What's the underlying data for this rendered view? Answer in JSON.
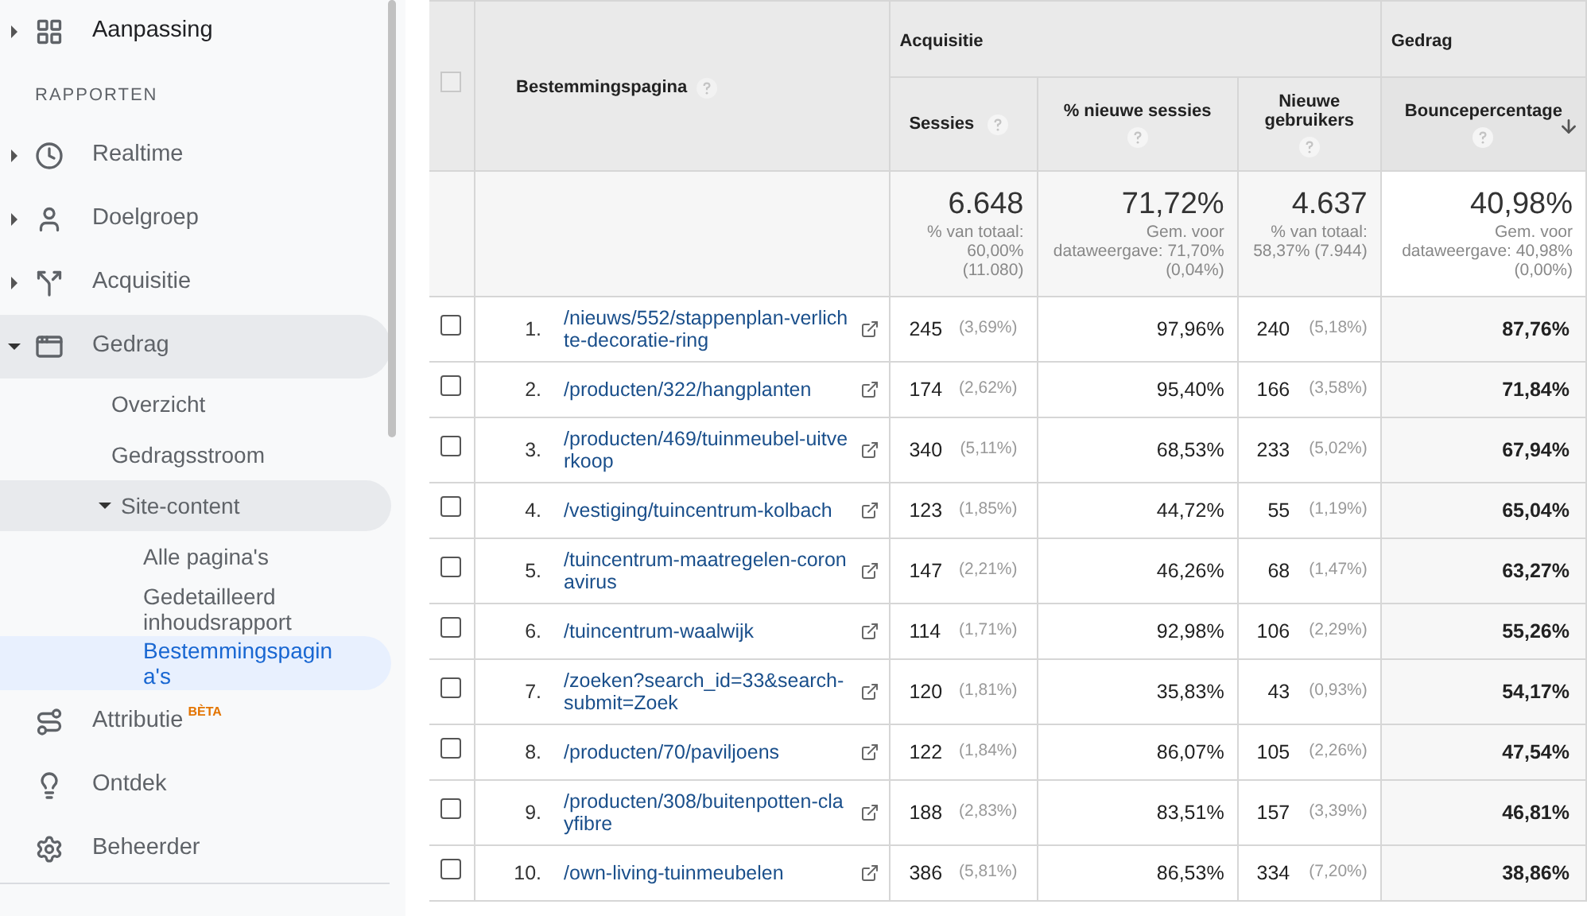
{
  "sidebar": {
    "items": [
      {
        "kind": "link",
        "label": "Aanpassing",
        "expanded": false
      },
      {
        "kind": "heading",
        "label": "RAPPORTEN"
      },
      {
        "kind": "link",
        "label": "Realtime",
        "expanded": false
      },
      {
        "kind": "link",
        "label": "Doelgroep",
        "expanded": false
      },
      {
        "kind": "link",
        "label": "Acquisitie",
        "expanded": false
      },
      {
        "kind": "link",
        "label": "Gedrag",
        "expanded": true,
        "children": [
          {
            "label": "Overzicht",
            "selected": false
          },
          {
            "label": "Gedragsstroom",
            "selected": false
          },
          {
            "label": "Site-content",
            "expanded": true,
            "children": [
              {
                "label": "Alle pagina's",
                "selected": false
              },
              {
                "label": "Gedetailleerd inhoudsrapport",
                "selected": false
              },
              {
                "label": "Bestemmingspagina's",
                "selected": true
              }
            ]
          }
        ]
      },
      {
        "kind": "link",
        "label": "Attributie",
        "badge": "BÈTA"
      },
      {
        "kind": "link",
        "label": "Ontdek"
      },
      {
        "kind": "link",
        "label": "Beheerder"
      }
    ]
  },
  "table": {
    "header_checkbox": {
      "checked": false
    },
    "dimension": {
      "label": "Bestemmingspagina"
    },
    "groups": [
      {
        "label": "Acquisitie"
      },
      {
        "label": "Gedrag"
      }
    ],
    "columns": [
      {
        "label": "Sessies",
        "sorted": false
      },
      {
        "label": "% nieuwe sessies",
        "sorted": false
      },
      {
        "label": "Nieuwe gebruikers",
        "sorted": false
      },
      {
        "label": "Bouncepercentage",
        "sorted": true
      }
    ],
    "totals": [
      {
        "value": "6.648",
        "note": "% van totaal: 60,00% (11.080)"
      },
      {
        "value": "71,72%",
        "note": "Gem. voor dataweergave: 71,70% (0,04%)"
      },
      {
        "value": "4.637",
        "note": "% van totaal: 58,37% (7.944)"
      },
      {
        "value": "40,98%",
        "note": "Gem. voor dataweergave: 40,98% (0,00%)"
      }
    ],
    "rows": [
      {
        "checked": false,
        "number": "1.",
        "page": "/nieuws/552/stappenplan-verlichte-decoratie-ring",
        "sessions": "245",
        "sessions_share": "(3,69%)",
        "new_sessions_pct": "97,96%",
        "new_users": "240",
        "new_users_share": "(5,18%)",
        "bounce": "87,76%"
      },
      {
        "checked": false,
        "number": "2.",
        "page": "/producten/322/hangplanten",
        "sessions": "174",
        "sessions_share": "(2,62%)",
        "new_sessions_pct": "95,40%",
        "new_users": "166",
        "new_users_share": "(3,58%)",
        "bounce": "71,84%"
      },
      {
        "checked": false,
        "number": "3.",
        "page": "/producten/469/tuinmeubel-uitverkoop",
        "sessions": "340",
        "sessions_share": "(5,11%)",
        "new_sessions_pct": "68,53%",
        "new_users": "233",
        "new_users_share": "(5,02%)",
        "bounce": "67,94%"
      },
      {
        "checked": false,
        "number": "4.",
        "page": "/vestiging/tuincentrum-kolbach",
        "sessions": "123",
        "sessions_share": "(1,85%)",
        "new_sessions_pct": "44,72%",
        "new_users": "55",
        "new_users_share": "(1,19%)",
        "bounce": "65,04%"
      },
      {
        "checked": false,
        "number": "5.",
        "page": "/tuincentrum-maatregelen-coronavirus",
        "sessions": "147",
        "sessions_share": "(2,21%)",
        "new_sessions_pct": "46,26%",
        "new_users": "68",
        "new_users_share": "(1,47%)",
        "bounce": "63,27%"
      },
      {
        "checked": false,
        "number": "6.",
        "page": "/tuincentrum-waalwijk",
        "sessions": "114",
        "sessions_share": "(1,71%)",
        "new_sessions_pct": "92,98%",
        "new_users": "106",
        "new_users_share": "(2,29%)",
        "bounce": "55,26%"
      },
      {
        "checked": false,
        "number": "7.",
        "page": "/zoeken?search_id=33&search-submit=Zoek",
        "sessions": "120",
        "sessions_share": "(1,81%)",
        "new_sessions_pct": "35,83%",
        "new_users": "43",
        "new_users_share": "(0,93%)",
        "bounce": "54,17%"
      },
      {
        "checked": false,
        "number": "8.",
        "page": "/producten/70/paviljoens",
        "sessions": "122",
        "sessions_share": "(1,84%)",
        "new_sessions_pct": "86,07%",
        "new_users": "105",
        "new_users_share": "(2,26%)",
        "bounce": "47,54%"
      },
      {
        "checked": false,
        "number": "9.",
        "page": "/producten/308/buitenpotten-clayfibre",
        "sessions": "188",
        "sessions_share": "(2,83%)",
        "new_sessions_pct": "83,51%",
        "new_users": "157",
        "new_users_share": "(3,39%)",
        "bounce": "46,81%"
      },
      {
        "checked": false,
        "number": "10.",
        "page": "/own-living-tuinmeubelen",
        "sessions": "386",
        "sessions_share": "(5,81%)",
        "new_sessions_pct": "86,53%",
        "new_users": "334",
        "new_users_share": "(7,20%)",
        "bounce": "38,86%"
      }
    ]
  }
}
